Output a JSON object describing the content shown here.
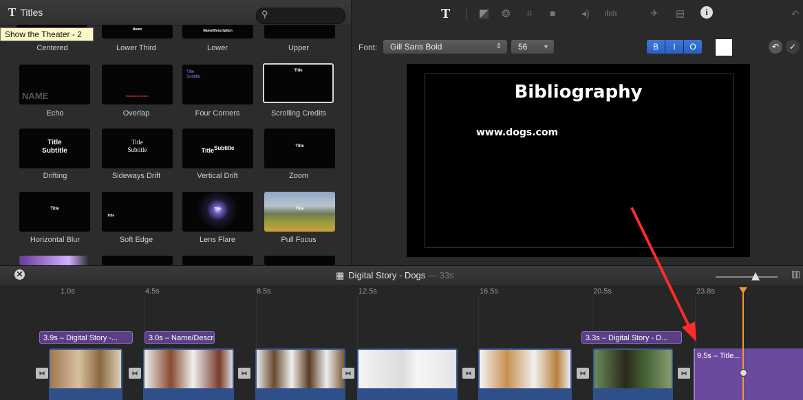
{
  "browser": {
    "title": "Titles",
    "tooltip": "Show the Theater - 2",
    "top_row_labels": [
      "Centered",
      "Lower Third",
      "Lower",
      "Upper"
    ],
    "top_row_thumb_text": [
      "Name",
      "Name/Description"
    ],
    "tiles": [
      {
        "label": "Echo",
        "thumb": "NAME"
      },
      {
        "label": "Overlap",
        "thumb": "NameDescription"
      },
      {
        "label": "Four Corners",
        "thumb_title": "Title",
        "thumb_sub": "Subtitle"
      },
      {
        "label": "Scrolling Credits",
        "thumb": "Title"
      },
      {
        "label": "Drifting",
        "thumb_title": "Title",
        "thumb_sub": "Subtitle"
      },
      {
        "label": "Sideways Drift",
        "thumb_title": "Title",
        "thumb_sub": "Subtitle"
      },
      {
        "label": "Vertical Drift",
        "thumb_title": "Title",
        "thumb_sub": "Subtitle"
      },
      {
        "label": "Zoom",
        "thumb": "Title"
      },
      {
        "label": "Horizontal Blur",
        "thumb": "Title"
      },
      {
        "label": "Soft Edge",
        "thumb": "Title"
      },
      {
        "label": "Lens Flare",
        "thumb": "Title"
      },
      {
        "label": "Pull Focus",
        "thumb": "Title"
      }
    ]
  },
  "viewer": {
    "font_label": "Font:",
    "font_name": "Gill Sans Bold",
    "font_size": "56",
    "format_buttons": [
      "B",
      "I",
      "O"
    ],
    "title_text": "Bibliography",
    "subtitle_text": "www.dogs.com",
    "text_color": "#ffffff",
    "toolbar_glyph": "T"
  },
  "timeline": {
    "project_title": "Digital Story - Dogs",
    "duration": "— 33s",
    "ticks": [
      "1.0s",
      "4.5s",
      "8.5s",
      "12.5s",
      "16.5s",
      "20.5s",
      "23.8s"
    ],
    "title_clips": [
      "3.9s – Digital Story -...",
      "3.0s – Name/Descri...",
      "3.3s – Digital Story - D..."
    ],
    "final_clip": "9.5s – Title..."
  },
  "colors": {
    "accent_blue": "#2a5fc0",
    "title_clip_purple": "#6a4a9e",
    "playhead": "#f0963a",
    "annotation_arrow": "#ff2a2a"
  }
}
